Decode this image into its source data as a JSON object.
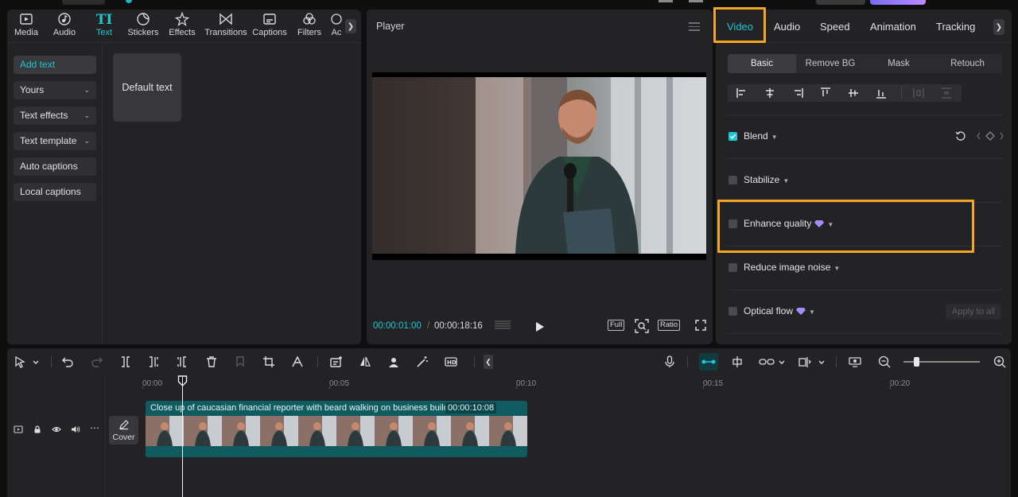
{
  "media_tabs": [
    {
      "label": "Media",
      "icon": "media-icon"
    },
    {
      "label": "Audio",
      "icon": "audio-icon"
    },
    {
      "label": "Text",
      "icon": "text-icon",
      "active": true
    },
    {
      "label": "Stickers",
      "icon": "sticker-icon"
    },
    {
      "label": "Effects",
      "icon": "effects-icon"
    },
    {
      "label": "Transitions",
      "icon": "transitions-icon"
    },
    {
      "label": "Captions",
      "icon": "captions-icon"
    },
    {
      "label": "Filters",
      "icon": "filters-icon"
    },
    {
      "label": "Ac",
      "icon": "adjust-icon"
    }
  ],
  "text_icon_glyph": "TI",
  "text_sidebar": [
    {
      "label": "Add text",
      "active": true
    },
    {
      "label": "Yours",
      "dropdown": true
    },
    {
      "label": "Text effects",
      "dropdown": true
    },
    {
      "label": "Text template",
      "dropdown": true
    },
    {
      "label": "Auto captions"
    },
    {
      "label": "Local captions"
    }
  ],
  "text_card": {
    "label": "Default text"
  },
  "player": {
    "title": "Player",
    "current_time": "00:00:01:00",
    "separator": "/",
    "total_time": "00:00:18:16",
    "full_label": "Full",
    "ratio_label": "Ratio"
  },
  "right_tabs": [
    {
      "label": "Video",
      "active": true
    },
    {
      "label": "Audio"
    },
    {
      "label": "Speed"
    },
    {
      "label": "Animation"
    },
    {
      "label": "Tracking"
    }
  ],
  "video_subtabs": [
    {
      "label": "Basic",
      "active": true
    },
    {
      "label": "Remove BG"
    },
    {
      "label": "Mask"
    },
    {
      "label": "Retouch"
    }
  ],
  "options": [
    {
      "label": "Blend",
      "checked": true
    },
    {
      "label": "Stabilize",
      "checked": false
    },
    {
      "label": "Enhance quality",
      "checked": false,
      "premium": true
    },
    {
      "label": "Reduce image noise",
      "checked": false
    },
    {
      "label": "Optical flow",
      "checked": false,
      "premium": true
    }
  ],
  "apply_to_all": "Apply to all",
  "timeline": {
    "ruler_labels": [
      "00:00",
      "00:05",
      "00:10",
      "00:15",
      "00:20"
    ],
    "clip_title": "Close up of caucasian financial reporter with beard walking on business building",
    "clip_duration": "00:00:10:08",
    "cover_label": "Cover"
  },
  "colors": {
    "accent": "#1fc6d4",
    "highlight": "#f5a623",
    "clip": "#0f5b60",
    "premium": "#a78bfa"
  }
}
